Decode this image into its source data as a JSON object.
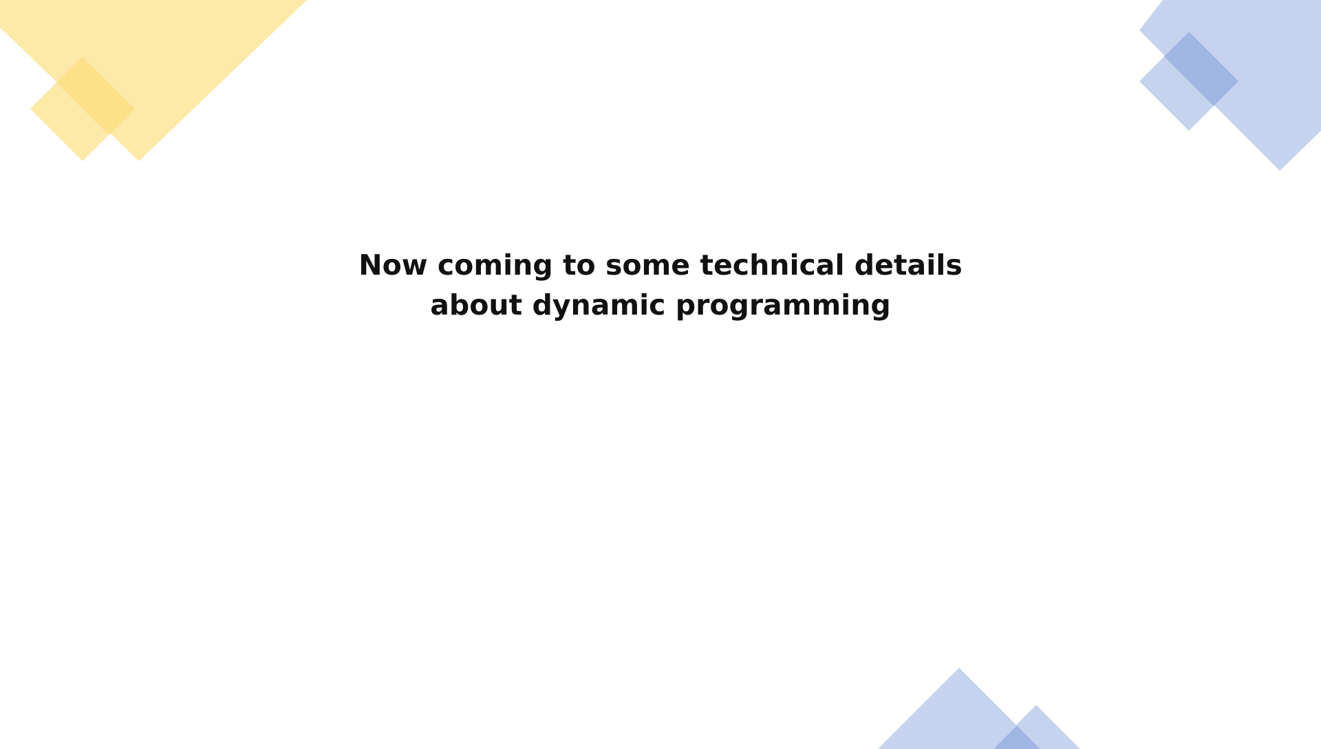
{
  "slide": {
    "title_line_1": "Now coming to some technical details",
    "title_line_2": "about dynamic programming"
  },
  "colors": {
    "background": "#ffffff",
    "text": "#111111",
    "accent_yellow": "#fde9a8",
    "accent_yellow_dark": "#fde08a",
    "accent_blue": "#c6d3ee",
    "accent_blue_dark": "#9fb5e2"
  }
}
